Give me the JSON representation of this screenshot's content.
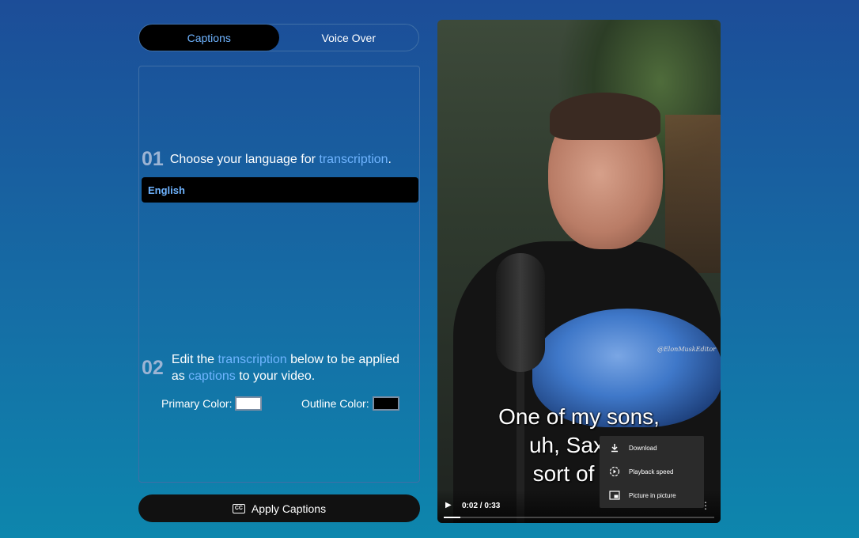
{
  "tabs": [
    {
      "label": "Captions",
      "active": true
    },
    {
      "label": "Voice Over",
      "active": false
    }
  ],
  "step1": {
    "number": "01",
    "text_before": "Choose your language for ",
    "highlight": "transcription",
    "text_after": "."
  },
  "language": {
    "selected": "English"
  },
  "step2": {
    "number": "02",
    "text_part1": "Edit the ",
    "highlight1": "transcription",
    "text_part2": " below to be applied as ",
    "highlight2": "captions",
    "text_part3": " to your video."
  },
  "colors": {
    "primary_label": "Primary Color:",
    "primary_value": "#ffffff",
    "outline_label": "Outline Color:",
    "outline_value": "#000000",
    "accent": "#6fb4ff"
  },
  "apply_button": {
    "label": "Apply Captions",
    "icon": "cc-icon"
  },
  "video": {
    "watermark": "@ElonMuskEditor",
    "caption_lines": [
      "One of my sons,",
      "uh, Saxon",
      "sort of au"
    ],
    "time": "0:02 / 0:33",
    "progress": 0.06
  },
  "video_menu": {
    "items": [
      {
        "label": "Download",
        "icon": "download-icon"
      },
      {
        "label": "Playback speed",
        "icon": "playback-speed-icon"
      },
      {
        "label": "Picture in picture",
        "icon": "picture-in-picture-icon"
      }
    ]
  }
}
